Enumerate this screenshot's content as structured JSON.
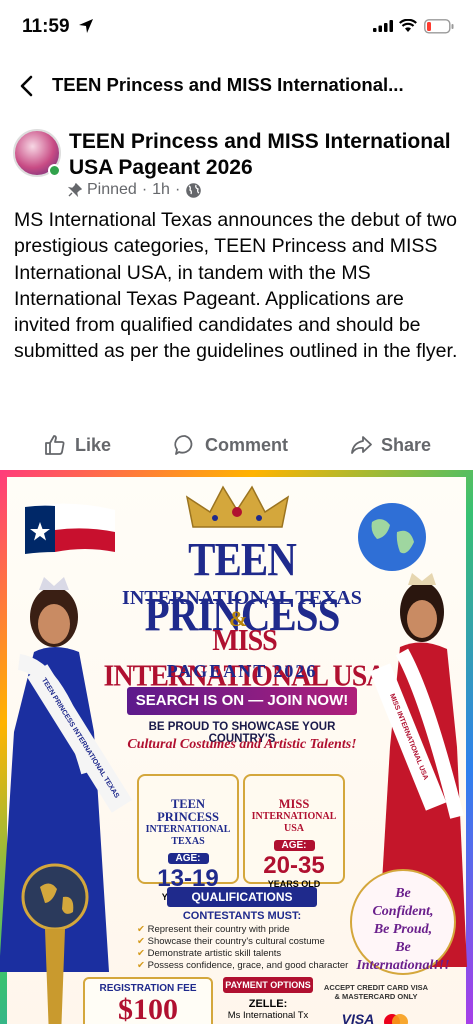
{
  "status_bar": {
    "time": "11:59"
  },
  "header": {
    "title": "TEEN Princess and MISS International..."
  },
  "post": {
    "title": "TEEN Princess and MISS International  USA Pageant 2026",
    "pinned_label": "Pinned",
    "age": "1h",
    "separator": "·",
    "body": "MS International Texas announces the debut of two prestigious categories, TEEN Princess and MISS International USA, in tandem with the MS International Texas Pageant. Applications are invited from qualified candidates and should be submitted as per the guidelines outlined in the flyer."
  },
  "actions": {
    "like": "Like",
    "comment": "Comment",
    "share": "Share"
  },
  "flyer": {
    "title1": "TEEN PRINCESS",
    "title2": "INTERNATIONAL TEXAS",
    "amp": "&",
    "title3": "MISS INTERNATIONAL USA",
    "pageant": "PAGEANT 2026",
    "search": "SEARCH IS ON — JOIN NOW!",
    "proud": "BE PROUD TO SHOWCASE YOUR COUNTRY'S",
    "talent": "Cultural Costumes and Artistic Talents!",
    "card1": {
      "title": "TEEN PRINCESS",
      "sub": "INTERNATIONAL TEXAS",
      "age_label": "AGE:",
      "range": "13-19",
      "years": "YEARS OLD"
    },
    "card2": {
      "title": "MISS",
      "sub": "INTERNATIONAL USA",
      "age_label": "AGE:",
      "range": "20-35",
      "years": "YEARS OLD"
    },
    "qualifications": "QUALIFICATIONS",
    "contestants_must": "CONTESTANTS MUST:",
    "requirements": [
      "Represent their country with pride",
      "Showcase their country's cultural costume",
      "Demonstrate artistic skill talents",
      "Possess confidence, grace, and good character"
    ],
    "badge": [
      "Be",
      "Confident,",
      "Be Proud,",
      "Be",
      "International!!!"
    ],
    "registration_label": "REGISTRATION FEE",
    "fee": "$100",
    "payment_label": "PAYMENT OPTIONS",
    "zelle": "ZELLE:",
    "zelle_to": "Ms International Tx",
    "cc_text": "ACCEPT CREDIT CARD VISA & MASTERCARD ONLY",
    "visa": "VISA",
    "sash_left": "TEEN PRINCESS INTERNATIONAL TEXAS",
    "sash_right": "MISS INTERNATIONAL USA"
  },
  "colors": {
    "meta_gray": "#65676b",
    "online_green": "#31a24c",
    "flyer_blue": "#1f2a8c",
    "flyer_red": "#b01030"
  }
}
